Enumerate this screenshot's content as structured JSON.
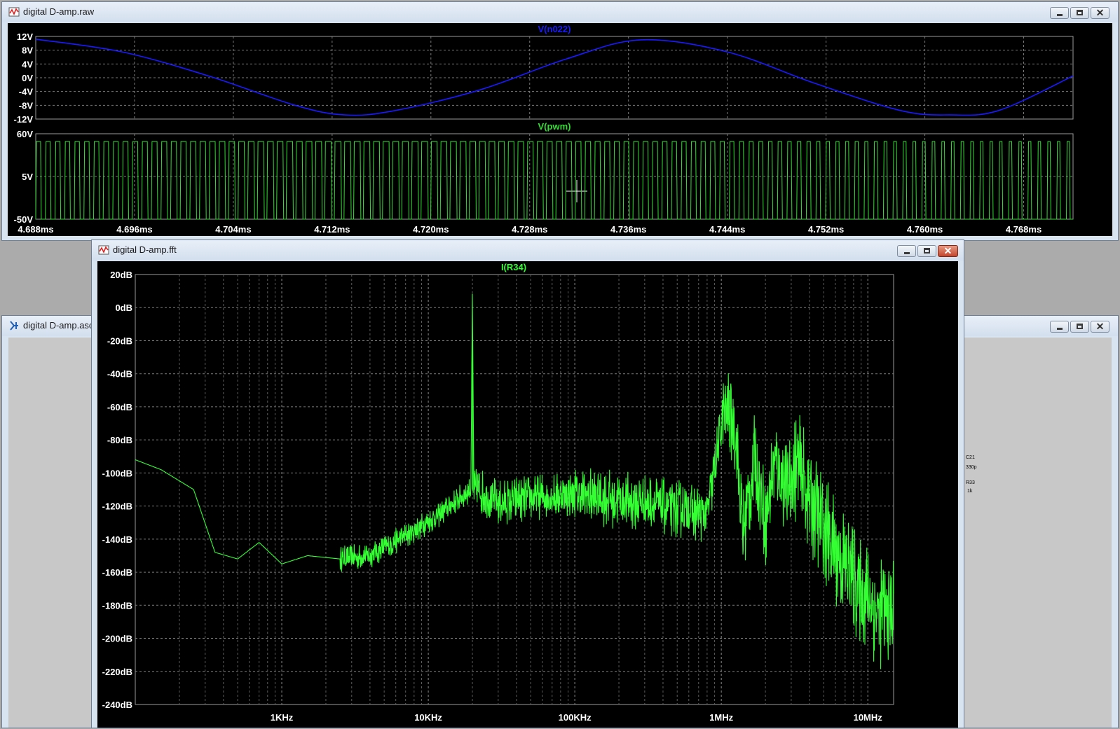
{
  "raw_window": {
    "title": "digital D-amp.raw",
    "pane1": {
      "trace_label": "V(n022)",
      "trace_color": "#1a1aff",
      "y_ticks": [
        "12V",
        "8V",
        "4V",
        "0V",
        "-4V",
        "-8V",
        "-12V"
      ]
    },
    "pane2": {
      "trace_label": "V(pwm)",
      "trace_color": "#33dd33",
      "y_ticks": [
        "60V",
        "5V",
        "-50V"
      ]
    },
    "x_ticks": [
      "4.688ms",
      "4.696ms",
      "4.704ms",
      "4.712ms",
      "4.720ms",
      "4.728ms",
      "4.736ms",
      "4.744ms",
      "4.752ms",
      "4.760ms",
      "4.768ms"
    ]
  },
  "asc_window": {
    "title": "digital D-amp.asc",
    "schematic_fragments": [
      "C21",
      "330p",
      "R33",
      "1k"
    ]
  },
  "fft_window": {
    "title": "digital D-amp.fft",
    "trace_label": "I(R34)",
    "trace_color": "#33ff33",
    "y_ticks": [
      "20dB",
      "0dB",
      "-20dB",
      "-40dB",
      "-60dB",
      "-80dB",
      "-100dB",
      "-120dB",
      "-140dB",
      "-160dB",
      "-180dB",
      "-200dB",
      "-220dB",
      "-240dB"
    ],
    "x_ticks": [
      "1KHz",
      "10KHz",
      "100KHz",
      "1MHz",
      "10MHz"
    ]
  },
  "chart_data": [
    {
      "type": "line",
      "title": "V(n022)",
      "x_unit": "ms",
      "xlim": [
        4.688,
        4.772
      ],
      "ylim": [
        -12,
        12
      ],
      "x": [
        4.688,
        4.695,
        4.702,
        4.709,
        4.713,
        4.717,
        4.724,
        4.731,
        4.737,
        4.744,
        4.751,
        4.758,
        4.762,
        4.766,
        4.772
      ],
      "series": [
        {
          "name": "V(n022)",
          "values": [
            11.2,
            7.5,
            0.5,
            -8.0,
            -10.8,
            -9.6,
            -3.5,
            5.5,
            11.0,
            7.5,
            -1.5,
            -9.5,
            -10.8,
            -9.5,
            0.5
          ]
        }
      ]
    },
    {
      "type": "line",
      "title": "V(pwm)",
      "x_unit": "ms",
      "xlim": [
        4.688,
        4.772
      ],
      "ylim": [
        -50,
        60
      ],
      "series": [
        {
          "name": "V(pwm)",
          "low": -50,
          "high": 50,
          "period_ms": 0.00078
        }
      ]
    },
    {
      "type": "line",
      "title": "I(R34)",
      "x_scale": "log",
      "xlim": [
        100,
        15000000
      ],
      "ylim": [
        -240,
        20
      ],
      "x": [
        100,
        150,
        250,
        350,
        500,
        700,
        1000,
        1500,
        2500,
        4000,
        7000,
        12000,
        18000,
        19500,
        20000,
        20500,
        22000,
        30000,
        50000,
        100000,
        300000,
        800000,
        1050000,
        1150000,
        1250000,
        1400000,
        1700000,
        2000000,
        2300000,
        2800000,
        3300000,
        4000000,
        5500000,
        8000000,
        12000000
      ],
      "series": [
        {
          "name": "I(R34)",
          "values": [
            -92,
            -98,
            -110,
            -148,
            -152,
            -142,
            -155,
            -150,
            -152,
            -150,
            -138,
            -125,
            -112,
            -110,
            0,
            -112,
            -110,
            -118,
            -115,
            -113,
            -118,
            -125,
            -62,
            -63,
            -75,
            -138,
            -90,
            -130,
            -92,
            -110,
            -95,
            -115,
            -140,
            -165,
            -185
          ]
        }
      ]
    }
  ]
}
